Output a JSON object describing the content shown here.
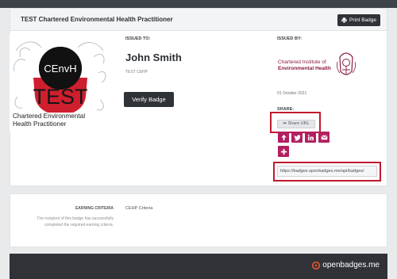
{
  "header": {
    "title": "TEST Chartered Environmental Health Practitioner",
    "print_label": "Print Badge"
  },
  "badge": {
    "abbrev": "CEnvH",
    "stamp": "TEST",
    "line1": "Chartered Environmental",
    "line2": "Health Practitioner"
  },
  "recipient": {
    "label": "ISSUED TO:",
    "name": "John Smith",
    "sub": "TEST CEHP",
    "verify_label": "Verify Badge"
  },
  "issuer": {
    "label": "ISSUED BY:",
    "name_line1": "Chartered Institute of",
    "name_line2": "Environmental Health",
    "date": "01 October 2021"
  },
  "share": {
    "label": "SHARE:",
    "share_url_label": "Share URL",
    "url": "https://badges.openbadges.me/api/badges/",
    "icons": [
      "upload-icon",
      "twitter-icon",
      "linkedin-icon",
      "email-icon",
      "plus-icon"
    ]
  },
  "criteria": {
    "label": "EARNING CRITERIA",
    "value": "CEHP Criteria",
    "description": "The recipient of this badge has successfully completed the required earning criteria."
  },
  "footer": {
    "brand": "openbadges.me"
  },
  "colors": {
    "dark": "#2f3338",
    "share_magenta": "#b21f60",
    "highlight_red": "#c2192f",
    "issuer_maroon": "#8b1a44"
  }
}
